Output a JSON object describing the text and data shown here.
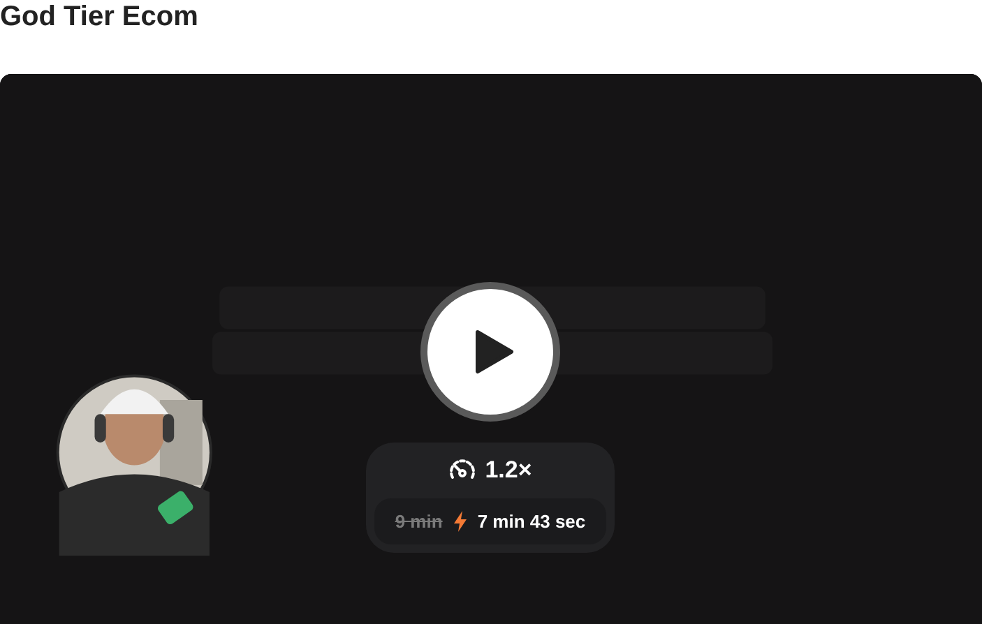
{
  "title": "God Tier Ecom",
  "video": {
    "kind": "picture",
    "speed": "1.2×",
    "original_duration": "9 min",
    "fast_duration": "7 min 43 sec"
  }
}
